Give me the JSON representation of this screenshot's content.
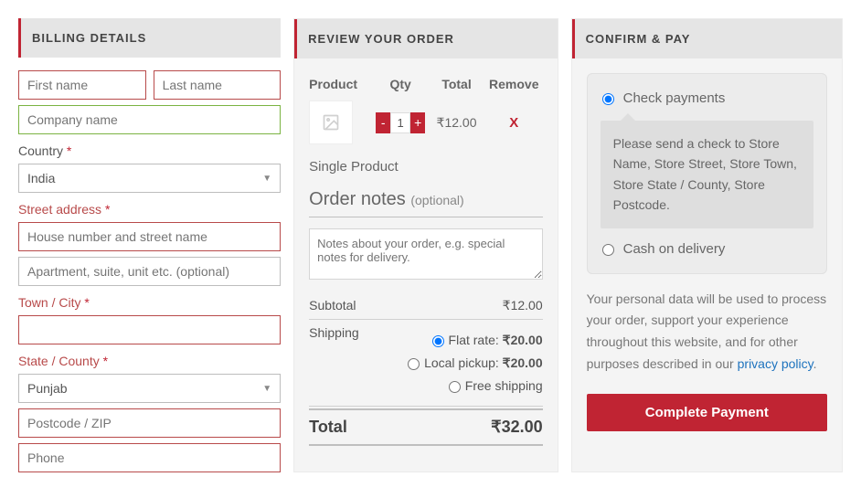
{
  "billing": {
    "header": "BILLING DETAILS",
    "required_mark": "*",
    "fields": {
      "first_name": {
        "label": "",
        "placeholder": "First name"
      },
      "last_name": {
        "label": "",
        "placeholder": "Last name"
      },
      "company": {
        "label": "",
        "placeholder": "Company name"
      },
      "country": {
        "label": "Country",
        "value": "India"
      },
      "street": {
        "label": "Street address",
        "placeholder1": "House number and street name",
        "placeholder2": "Apartment, suite, unit etc. (optional)"
      },
      "town": {
        "label": "Town / City",
        "placeholder": ""
      },
      "state": {
        "label": "State / County",
        "value": "Punjab"
      },
      "postcode": {
        "label": "",
        "placeholder": "Postcode / ZIP"
      },
      "phone": {
        "label": "",
        "placeholder": "Phone"
      }
    }
  },
  "review": {
    "header": "REVIEW YOUR ORDER",
    "columns": {
      "product": "Product",
      "qty": "Qty",
      "total": "Total",
      "remove": "Remove"
    },
    "item": {
      "name": "Single Product",
      "qty": "1",
      "total": "₹12.00",
      "remove": "X"
    },
    "order_notes_title": "Order notes",
    "order_notes_optional": "(optional)",
    "order_notes_placeholder": "Notes about your order, e.g. special notes for delivery.",
    "subtotal_label": "Subtotal",
    "subtotal_value": "₹12.00",
    "shipping_label": "Shipping",
    "shipping_options": {
      "flat": {
        "label": "Flat rate: ",
        "price": "₹20.00"
      },
      "local": {
        "label": "Local pickup: ",
        "price": "₹20.00"
      },
      "free": {
        "label": "Free shipping"
      }
    },
    "total_label": "Total",
    "total_value": "₹32.00"
  },
  "confirm": {
    "header": "CONFIRM & PAY",
    "check_label": "Check payments",
    "check_info": "Please send a check to Store Name, Store Street, Store Town, Store State / County, Store Postcode.",
    "cod_label": "Cash on delivery",
    "privacy_text": "Your personal data will be used to process your order, support your experience throughout this website, and for other purposes described in our ",
    "privacy_link": "privacy policy",
    "privacy_period": ".",
    "button": "Complete Payment"
  }
}
